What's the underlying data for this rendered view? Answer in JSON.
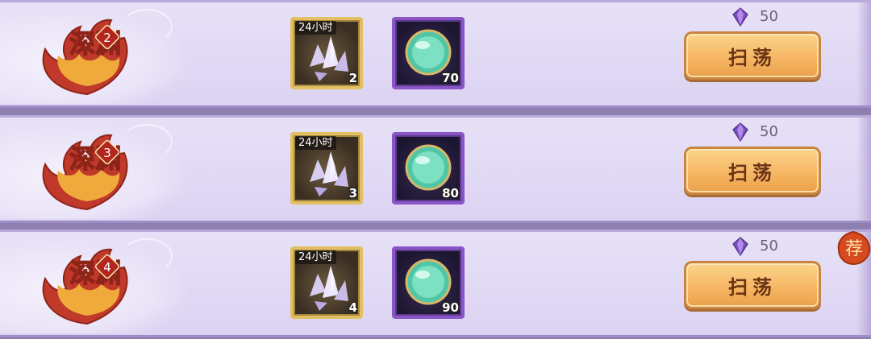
{
  "stages": [
    {
      "name": "深渊",
      "level": "2",
      "ticket_duration": "24小时",
      "ticket_qty": "2",
      "orb_qty": "70",
      "cost": "50",
      "button_label": "扫荡"
    },
    {
      "name": "深渊",
      "level": "3",
      "ticket_duration": "24小时",
      "ticket_qty": "3",
      "orb_qty": "80",
      "cost": "50",
      "button_label": "扫荡"
    },
    {
      "name": "深渊",
      "level": "4",
      "ticket_duration": "24小时",
      "ticket_qty": "4",
      "orb_qty": "90",
      "cost": "50",
      "button_label": "扫荡"
    }
  ],
  "recommend_badge": "荐",
  "colors": {
    "row_bg": "#dcd3f2",
    "button": "#f6b764",
    "gold_frame": "#e2bf62",
    "purple_frame": "#8a55c7",
    "emblem_red": "#c0392b"
  },
  "icons": {
    "ticket": "crystal-cluster-icon",
    "reward": "green-orb-icon",
    "currency": "purple-gem-icon"
  }
}
